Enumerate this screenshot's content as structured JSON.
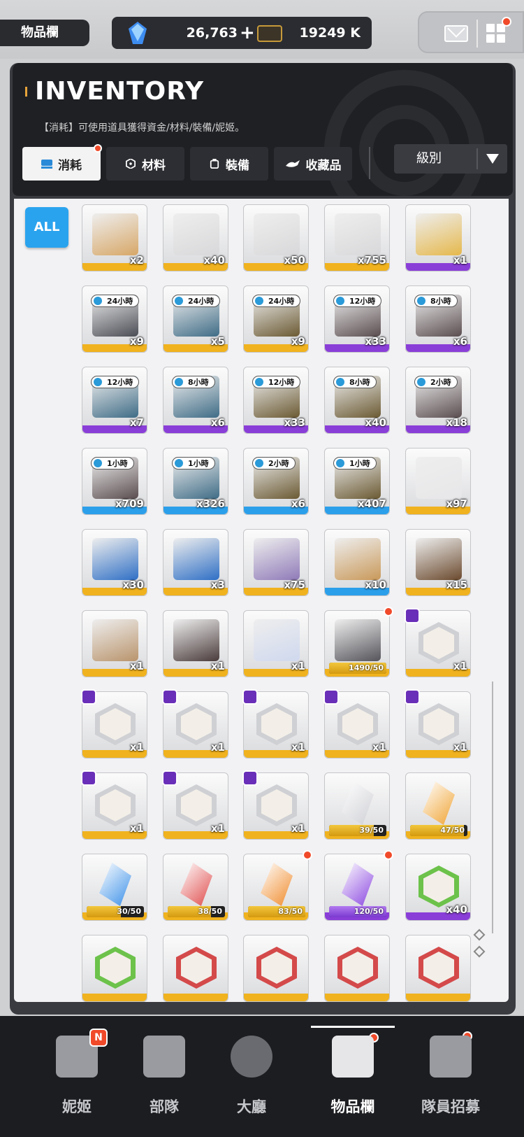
{
  "top": {
    "page_tag": "物品欄",
    "gems": "26,763",
    "plus": "+",
    "credits": "19249 K",
    "colors": {
      "red_dot": "#f04a2a"
    }
  },
  "header": {
    "title": "INVENTORY",
    "subtitle": "【消耗】可使用道具獲得資金/材料/裝備/妮姬。",
    "tabs": [
      {
        "label": "消耗",
        "icon": "consumable-icon"
      },
      {
        "label": "材料",
        "icon": "material-icon"
      },
      {
        "label": "裝備",
        "icon": "equipment-icon"
      },
      {
        "label": "收藏品",
        "icon": "collectible-icon"
      }
    ],
    "sort_label": "級別"
  },
  "filter": {
    "all_label": "ALL"
  },
  "rarity_colors": {
    "yellow": "#f0b21e",
    "purple": "#8a3ed8",
    "blue": "#2c9fea"
  },
  "items": [
    {
      "name": "gift-box",
      "qty": "x2",
      "rarity": "yellow",
      "color": "#d7a767"
    },
    {
      "name": "silver-case",
      "qty": "x40",
      "rarity": "yellow",
      "color": "#d8d8da"
    },
    {
      "name": "silver-case",
      "qty": "x50",
      "rarity": "yellow",
      "color": "#d8d8da"
    },
    {
      "name": "silver-case",
      "qty": "x755",
      "rarity": "yellow",
      "color": "#d8d8da"
    },
    {
      "name": "gold-box",
      "qty": "x1",
      "rarity": "purple",
      "color": "#e5b84c"
    },
    {
      "name": "supply-crate",
      "qty": "x9",
      "rarity": "yellow",
      "timer": "24小時",
      "color": "#4b4d55"
    },
    {
      "name": "supply-crate",
      "qty": "x5",
      "rarity": "yellow",
      "timer": "24小時",
      "color": "#3f6c86"
    },
    {
      "name": "supply-crate",
      "qty": "x9",
      "rarity": "yellow",
      "timer": "24小時",
      "color": "#6b5a33"
    },
    {
      "name": "supply-crate",
      "qty": "x33",
      "rarity": "purple",
      "timer": "12小時",
      "color": "#5a4d4f"
    },
    {
      "name": "supply-crate",
      "qty": "x6",
      "rarity": "purple",
      "timer": "8小時",
      "color": "#5a4d4f"
    },
    {
      "name": "supply-crate",
      "qty": "x7",
      "rarity": "purple",
      "timer": "12小時",
      "color": "#3f6c86"
    },
    {
      "name": "supply-crate",
      "qty": "x6",
      "rarity": "purple",
      "timer": "8小時",
      "color": "#3f6c86"
    },
    {
      "name": "supply-crate",
      "qty": "x33",
      "rarity": "purple",
      "timer": "12小時",
      "color": "#6b5a33"
    },
    {
      "name": "supply-crate",
      "qty": "x40",
      "rarity": "purple",
      "timer": "8小時",
      "color": "#6b5a33"
    },
    {
      "name": "supply-crate",
      "qty": "x18",
      "rarity": "purple",
      "timer": "2小時",
      "color": "#5a4d4f"
    },
    {
      "name": "supply-crate",
      "qty": "x709",
      "rarity": "blue",
      "timer": "1小時",
      "color": "#5a4d4f"
    },
    {
      "name": "supply-crate",
      "qty": "x326",
      "rarity": "blue",
      "timer": "1小時",
      "color": "#3f6c86"
    },
    {
      "name": "supply-crate",
      "qty": "x6",
      "rarity": "blue",
      "timer": "2小時",
      "color": "#6b5a33"
    },
    {
      "name": "supply-crate",
      "qty": "x407",
      "rarity": "blue",
      "timer": "1小時",
      "color": "#6b5a33"
    },
    {
      "name": "white-crate",
      "qty": "x97",
      "rarity": "yellow",
      "color": "#e7e7e9"
    },
    {
      "name": "blue-box",
      "qty": "x30",
      "rarity": "yellow",
      "color": "#2f6fc5"
    },
    {
      "name": "blue-box",
      "qty": "x3",
      "rarity": "yellow",
      "color": "#2f6fc5"
    },
    {
      "name": "decor-case",
      "qty": "x75",
      "rarity": "yellow",
      "color": "#8f7ab8"
    },
    {
      "name": "cardboard-box",
      "qty": "x10",
      "rarity": "blue",
      "color": "#c9995a"
    },
    {
      "name": "basket",
      "qty": "x15",
      "rarity": "yellow",
      "color": "#6b4a2e"
    },
    {
      "name": "cake",
      "qty": "x1",
      "rarity": "yellow",
      "color": "#b9946c"
    },
    {
      "name": "pot",
      "qty": "x1",
      "rarity": "yellow",
      "color": "#4a3b3b"
    },
    {
      "name": "keychain",
      "qty": "x1",
      "rarity": "yellow",
      "color": "#cfd8ee"
    },
    {
      "name": "card",
      "progress": "1490/50",
      "fill": 1.0,
      "rarity": "yellow",
      "red_dot": true,
      "color": "#55545a"
    },
    {
      "name": "portrait",
      "qty": "x1",
      "rarity": "yellow",
      "badge": true
    },
    {
      "name": "portrait",
      "qty": "x1",
      "rarity": "yellow",
      "badge": true
    },
    {
      "name": "portrait",
      "qty": "x1",
      "rarity": "yellow",
      "badge": true
    },
    {
      "name": "portrait",
      "qty": "x1",
      "rarity": "yellow",
      "badge": true
    },
    {
      "name": "portrait",
      "qty": "x1",
      "rarity": "yellow",
      "badge": true
    },
    {
      "name": "portrait",
      "qty": "x1",
      "rarity": "yellow",
      "badge": true
    },
    {
      "name": "portrait",
      "qty": "x1",
      "rarity": "yellow",
      "badge": true
    },
    {
      "name": "portrait",
      "qty": "x1",
      "rarity": "yellow",
      "badge": true
    },
    {
      "name": "portrait",
      "qty": "x1",
      "rarity": "yellow",
      "badge": true
    },
    {
      "name": "gem-white",
      "progress": "39/50",
      "fill": 0.78,
      "rarity": "yellow",
      "color": "#cfd0d5"
    },
    {
      "name": "gem-gold",
      "progress": "47/50",
      "fill": 0.94,
      "rarity": "yellow",
      "color": "#f0a332"
    },
    {
      "name": "gem-blue",
      "progress": "30/50",
      "fill": 0.6,
      "rarity": "yellow",
      "color": "#3a8fe8"
    },
    {
      "name": "gem-red",
      "progress": "38/50",
      "fill": 0.76,
      "rarity": "yellow",
      "color": "#e04a4a"
    },
    {
      "name": "gem-orange",
      "progress": "83/50",
      "fill": 1.0,
      "rarity": "yellow",
      "red_dot": true,
      "color": "#f08a2a"
    },
    {
      "name": "gem-purple",
      "progress": "120/50",
      "fill": 1.0,
      "rarity": "purple",
      "red_dot": true,
      "color": "#8a46e0"
    },
    {
      "name": "hex-green",
      "qty": "x40",
      "rarity": "purple",
      "color": "#6cc24a"
    },
    {
      "name": "hex-green",
      "qty": "",
      "rarity": "yellow",
      "color": "#6cc24a"
    },
    {
      "name": "hex-red",
      "qty": "",
      "rarity": "yellow",
      "color": "#d44a4a"
    },
    {
      "name": "hex-red",
      "qty": "",
      "rarity": "yellow",
      "color": "#d44a4a"
    },
    {
      "name": "hex-red",
      "qty": "",
      "rarity": "yellow",
      "color": "#d44a4a"
    },
    {
      "name": "hex-red",
      "qty": "",
      "rarity": "yellow",
      "color": "#d44a4a"
    }
  ],
  "nav": [
    {
      "label": "妮姬",
      "icon": "nikke-icon"
    },
    {
      "label": "部隊",
      "icon": "squad-icon"
    },
    {
      "label": "大廳",
      "icon": "lobby-icon"
    },
    {
      "label": "物品欄",
      "icon": "inventory-icon",
      "active": true
    },
    {
      "label": "隊員招募",
      "icon": "recruit-icon"
    }
  ],
  "nav_badge": "N"
}
